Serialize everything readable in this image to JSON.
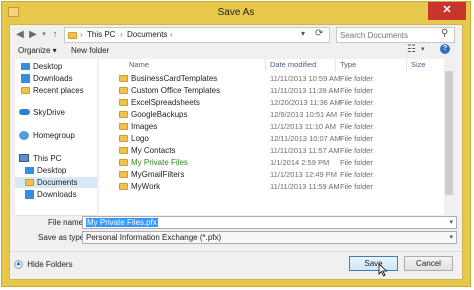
{
  "window": {
    "title": "Save As",
    "close_glyph": "✕"
  },
  "address": {
    "path": [
      "This PC",
      "Documents"
    ],
    "sep": "›"
  },
  "search": {
    "placeholder": "Search Documents"
  },
  "toolbar": {
    "organize": "Organize ▾",
    "new_folder": "New folder"
  },
  "nav": {
    "items": [
      {
        "label": "Desktop",
        "selected": false
      },
      {
        "label": "Downloads",
        "selected": false
      },
      {
        "label": "Recent places",
        "selected": false
      },
      {
        "label": "SkyDrive",
        "selected": false
      },
      {
        "label": "Homegroup",
        "selected": false
      },
      {
        "label": "This PC",
        "selected": false
      },
      {
        "label": "Desktop",
        "selected": false
      },
      {
        "label": "Documents",
        "selected": true
      },
      {
        "label": "Downloads",
        "selected": false
      }
    ]
  },
  "columns": {
    "name": "Name",
    "date": "Date modified",
    "type": "Type",
    "size": "Size"
  },
  "files": [
    {
      "name": "BusinessCardTemplates",
      "date": "11/11/2013 10:59 AM",
      "type": "File folder",
      "highlight": false
    },
    {
      "name": "Custom Office Templates",
      "date": "11/11/2013 11:39 AM",
      "type": "File folder",
      "highlight": false
    },
    {
      "name": "ExcelSpreadsheets",
      "date": "12/20/2013 11:36 AM",
      "type": "File folder",
      "highlight": false
    },
    {
      "name": "GoogleBackups",
      "date": "12/9/2013 10:51 AM",
      "type": "File folder",
      "highlight": false
    },
    {
      "name": "Images",
      "date": "11/1/2013 11:10 AM",
      "type": "File folder",
      "highlight": false
    },
    {
      "name": "Logo",
      "date": "12/11/2013 10:07 AM",
      "type": "File folder",
      "highlight": false
    },
    {
      "name": "My Contacts",
      "date": "11/11/2013 11:57 AM",
      "type": "File folder",
      "highlight": false
    },
    {
      "name": "My Private Files",
      "date": "1/1/2014 2:59 PM",
      "type": "File folder",
      "highlight": true
    },
    {
      "name": "MyGmailFilters",
      "date": "11/1/2013 12:49 PM",
      "type": "File folder",
      "highlight": false
    },
    {
      "name": "MyWork",
      "date": "11/11/2013 11:59 AM",
      "type": "File folder",
      "highlight": false
    }
  ],
  "form": {
    "filename_label": "File name:",
    "filename_value": "My Private Files.pfx",
    "type_label": "Save as type:",
    "type_value": "Personal Information Exchange (*.pfx)"
  },
  "footer": {
    "hide_folders": "Hide Folders",
    "save": "Save",
    "cancel": "Cancel"
  },
  "colors": {
    "accent_frame": "#e6c84b",
    "close": "#c7352c",
    "highlight_text": "#2d8a1f"
  }
}
